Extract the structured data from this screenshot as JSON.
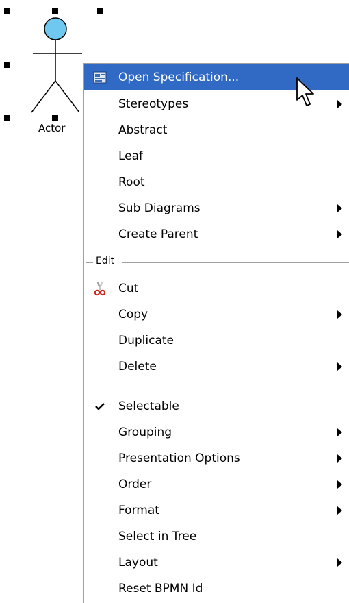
{
  "diagram": {
    "actor_label": "Actor",
    "actor_head_color": "#6ec8f0"
  },
  "menu": {
    "highlight_color": "#316ac5",
    "items_top": [
      {
        "label": "Open Specification...",
        "submenu": false,
        "icon": "specification-icon",
        "highlighted": true
      },
      {
        "label": "Stereotypes",
        "submenu": true
      },
      {
        "label": "Abstract",
        "submenu": false
      },
      {
        "label": "Leaf",
        "submenu": false
      },
      {
        "label": "Root",
        "submenu": false
      },
      {
        "label": "Sub Diagrams",
        "submenu": true
      },
      {
        "label": "Create Parent",
        "submenu": true
      }
    ],
    "edit_group_label": "Edit",
    "items_edit": [
      {
        "label": "Cut",
        "submenu": false,
        "icon": "scissors-icon"
      },
      {
        "label": "Copy",
        "submenu": true
      },
      {
        "label": "Duplicate",
        "submenu": false
      },
      {
        "label": "Delete",
        "submenu": true
      }
    ],
    "items_bottom": [
      {
        "label": "Selectable",
        "submenu": false,
        "checked": true,
        "icon": "checkmark-icon"
      },
      {
        "label": "Grouping",
        "submenu": true
      },
      {
        "label": "Presentation Options",
        "submenu": true
      },
      {
        "label": "Order",
        "submenu": true
      },
      {
        "label": "Format",
        "submenu": true
      },
      {
        "label": "Select in Tree",
        "submenu": false
      },
      {
        "label": "Layout",
        "submenu": true
      },
      {
        "label": "Reset BPMN Id",
        "submenu": false
      }
    ]
  }
}
